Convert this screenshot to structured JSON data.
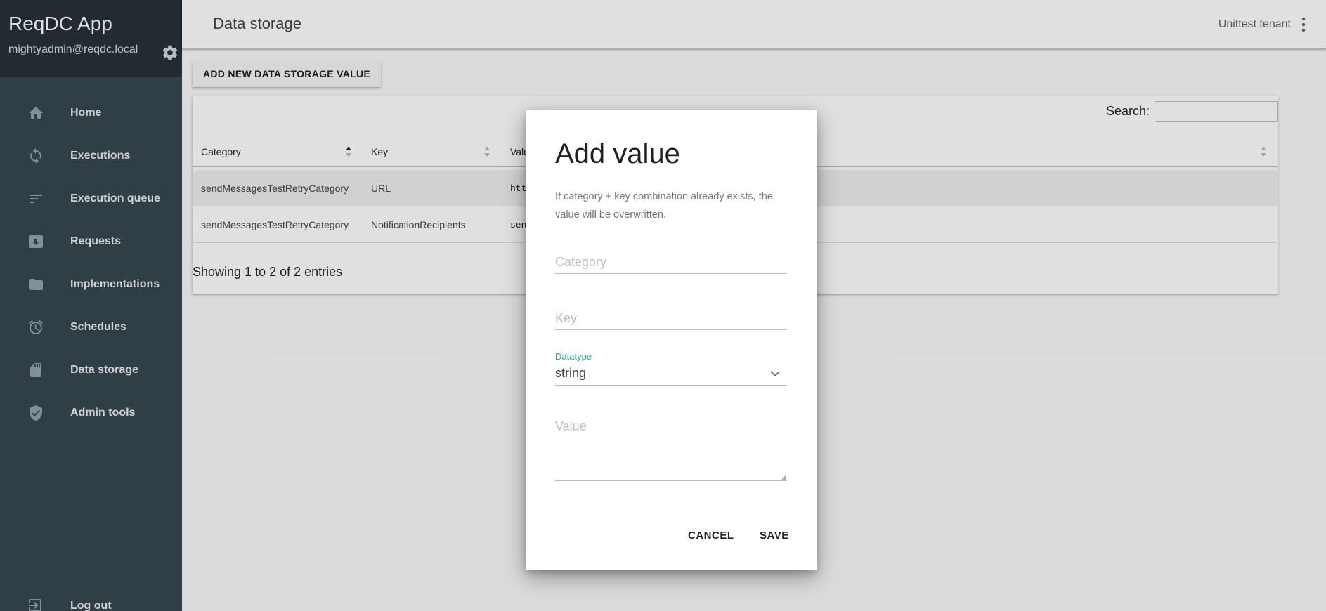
{
  "app": {
    "title": "ReqDC App",
    "user_email": "mightyadmin@reqdc.local"
  },
  "sidebar": {
    "items": [
      {
        "label": "Home",
        "icon": "home-icon"
      },
      {
        "label": "Executions",
        "icon": "refresh-icon"
      },
      {
        "label": "Execution queue",
        "icon": "queue-icon"
      },
      {
        "label": "Requests",
        "icon": "inbox-icon"
      },
      {
        "label": "Implementations",
        "icon": "folder-icon"
      },
      {
        "label": "Schedules",
        "icon": "alarm-icon"
      },
      {
        "label": "Data storage",
        "icon": "sd-card-icon"
      },
      {
        "label": "Admin tools",
        "icon": "shield-icon"
      }
    ],
    "logout_label": "Log out"
  },
  "header": {
    "page_title": "Data storage",
    "tenant": "Unittest tenant"
  },
  "main": {
    "add_button_label": "ADD NEW DATA STORAGE VALUE",
    "search_label": "Search:",
    "search_value": "",
    "columns": [
      "Category",
      "Key",
      "Valu"
    ],
    "rows": [
      {
        "category": "sendMessagesTestRetryCategory",
        "key": "URL",
        "value": "htt"
      },
      {
        "category": "sendMessagesTestRetryCategory",
        "key": "NotificationRecipients",
        "value": "sen"
      }
    ],
    "info": "Showing 1 to 2 of 2 entries"
  },
  "dialog": {
    "title": "Add value",
    "description": "If category + key combination already exists, the value will be overwritten.",
    "category_placeholder": "Category",
    "key_placeholder": "Key",
    "datatype_label": "Datatype",
    "datatype_value": "string",
    "value_placeholder": "Value",
    "cancel_label": "CANCEL",
    "save_label": "SAVE"
  },
  "colors": {
    "sidebar_bg": "#37474f",
    "sidebar_header_bg": "#263238",
    "accent": "#26a69a"
  }
}
